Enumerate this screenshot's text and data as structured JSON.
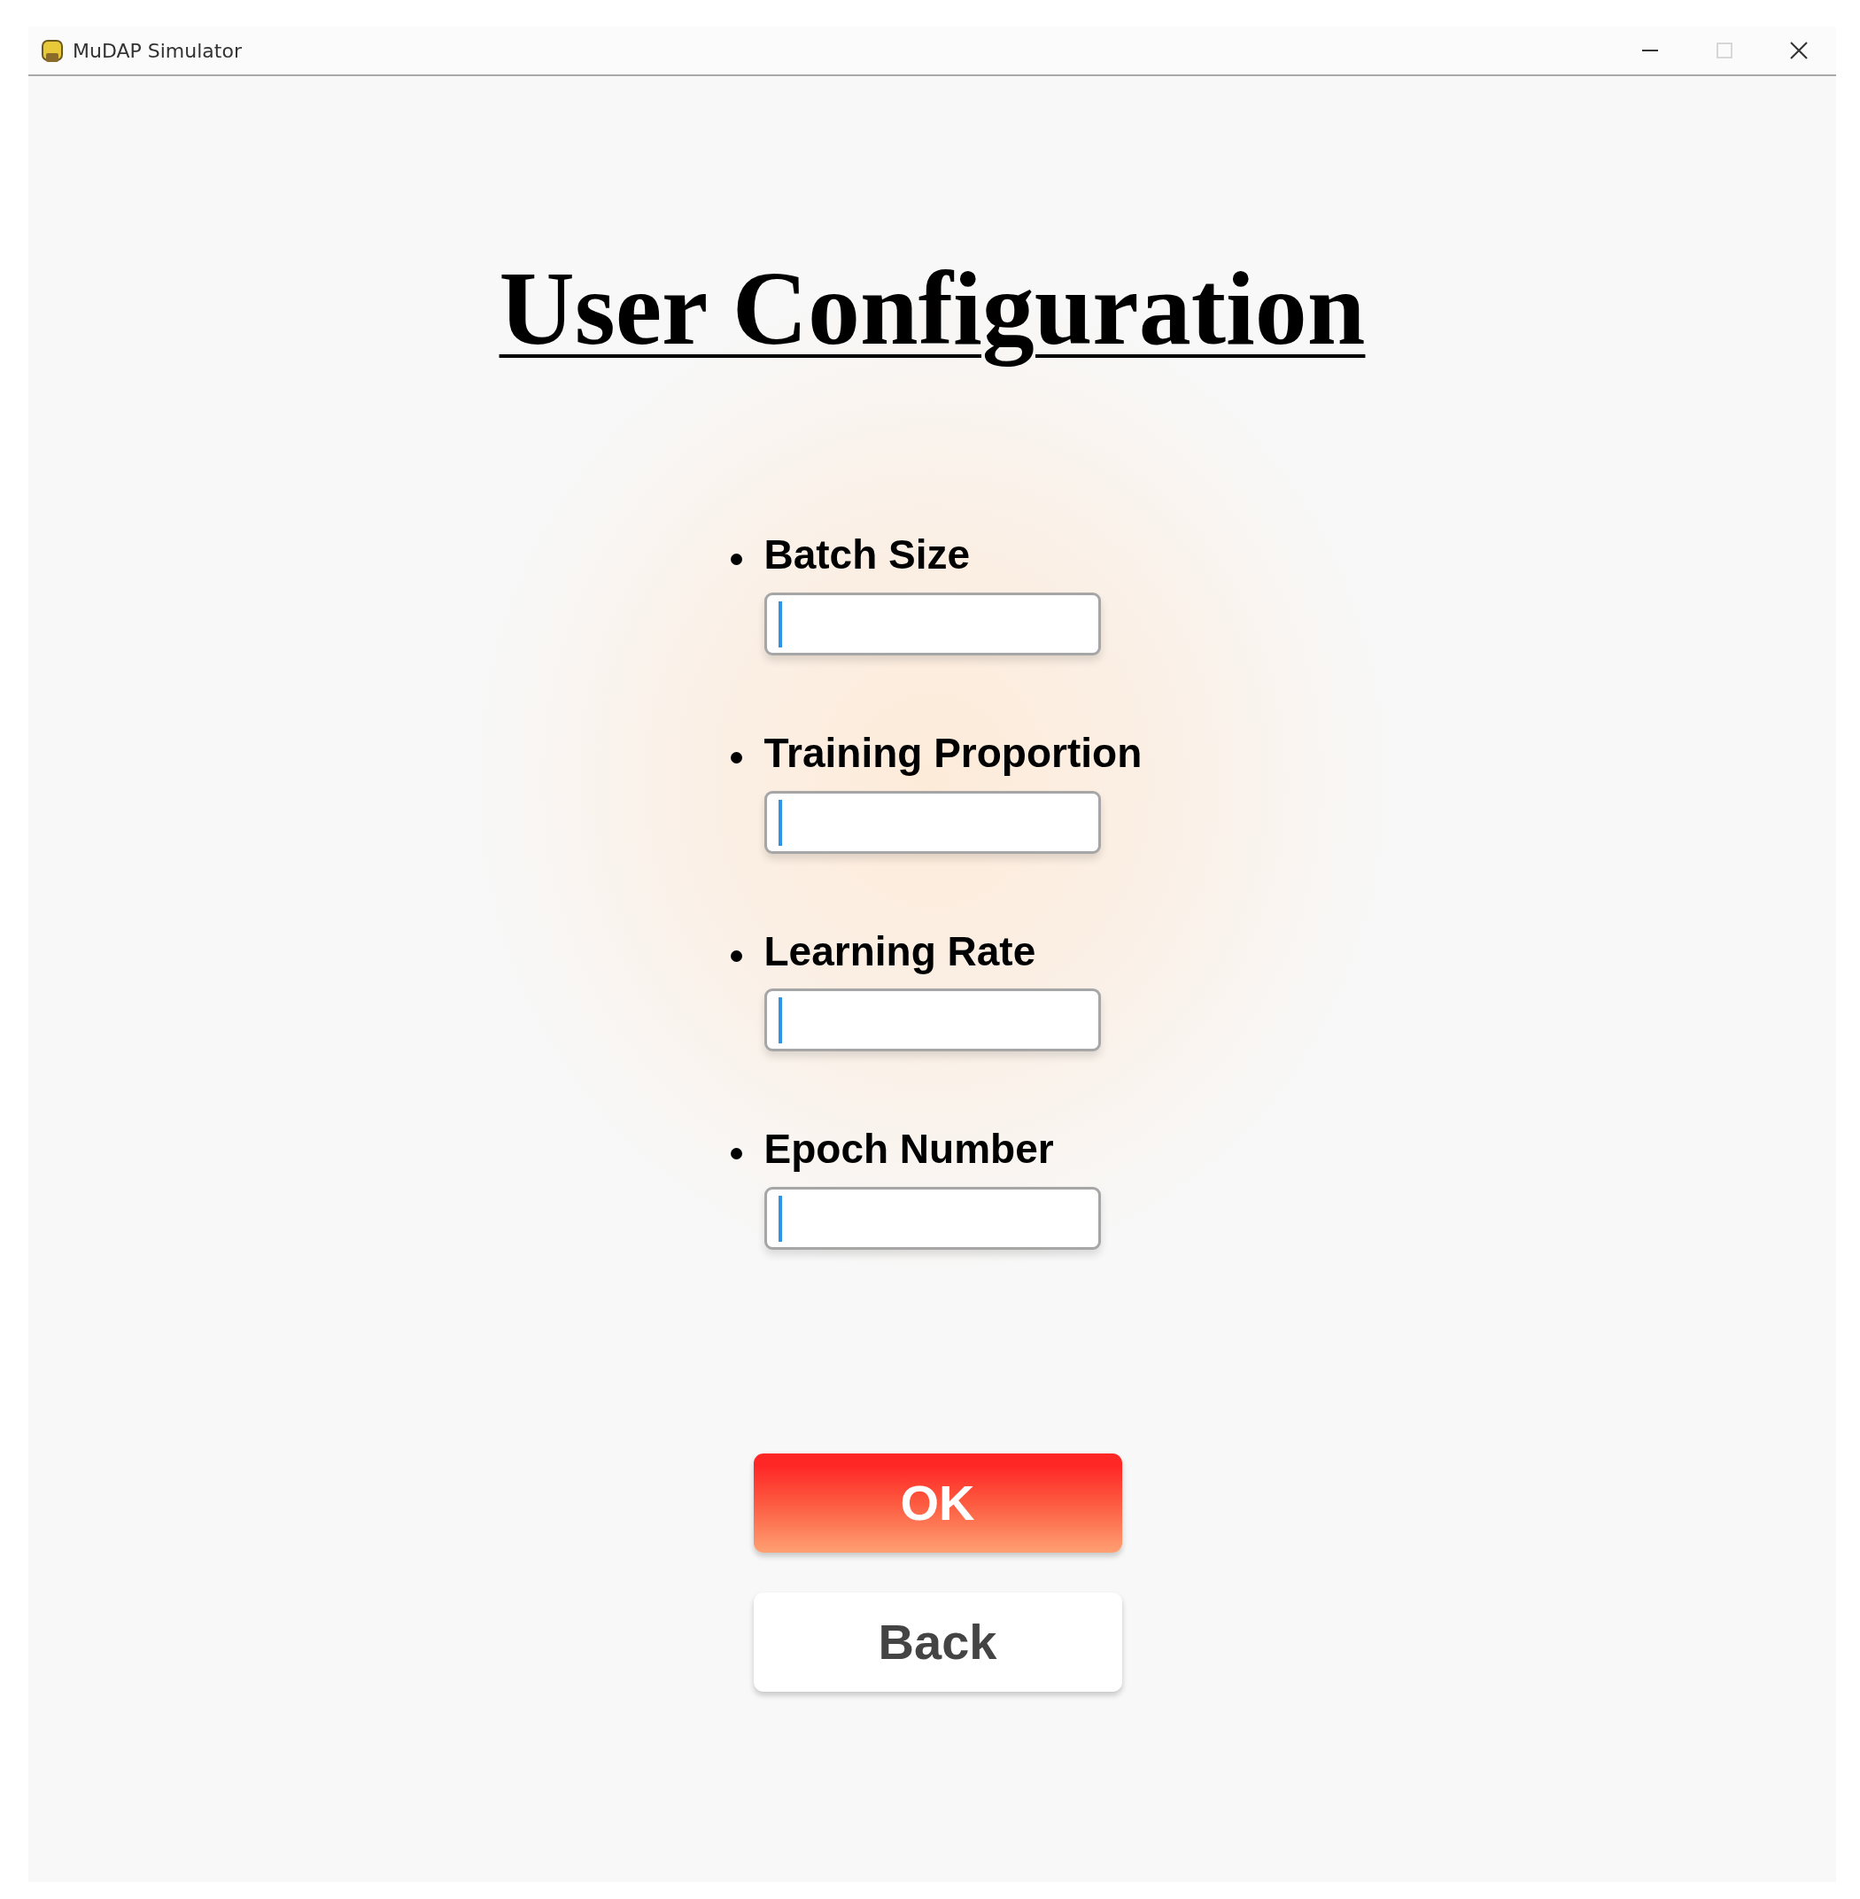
{
  "window": {
    "title": "MuDAP Simulator"
  },
  "heading": "User Configuration",
  "fields": [
    {
      "label": "Batch Size"
    },
    {
      "label": "Training Proportion"
    },
    {
      "label": "Learning Rate"
    },
    {
      "label": "Epoch Number"
    }
  ],
  "buttons": [
    {
      "label": "OK",
      "kind": "primary"
    },
    {
      "label": "Back",
      "kind": "secondary"
    }
  ]
}
